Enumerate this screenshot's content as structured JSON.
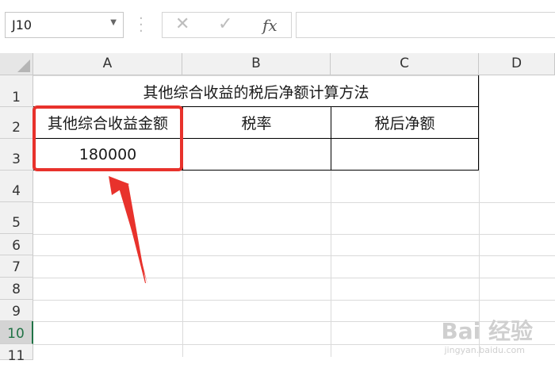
{
  "formula_bar": {
    "name_box": "J10",
    "cancel_icon": "✕",
    "enter_icon": "✓",
    "fx_label": "fx",
    "formula_value": ""
  },
  "columns": [
    "A",
    "B",
    "C",
    "D"
  ],
  "rows": [
    "1",
    "2",
    "3",
    "4",
    "5",
    "6",
    "7",
    "8",
    "9",
    "10",
    "11"
  ],
  "selected_row": "10",
  "cells": {
    "title": "其他综合收益的税后净额计算方法",
    "a2": "其他综合收益金额",
    "b2": "税率",
    "c2": "税后净额",
    "a3": "180000",
    "b3": "",
    "c3": ""
  },
  "annotation": {
    "highlight_color": "#e8322c",
    "icon": "red-arrow-icon"
  },
  "watermark": {
    "brand": "Bai 经验",
    "url": "jingyan.baidu.com"
  }
}
